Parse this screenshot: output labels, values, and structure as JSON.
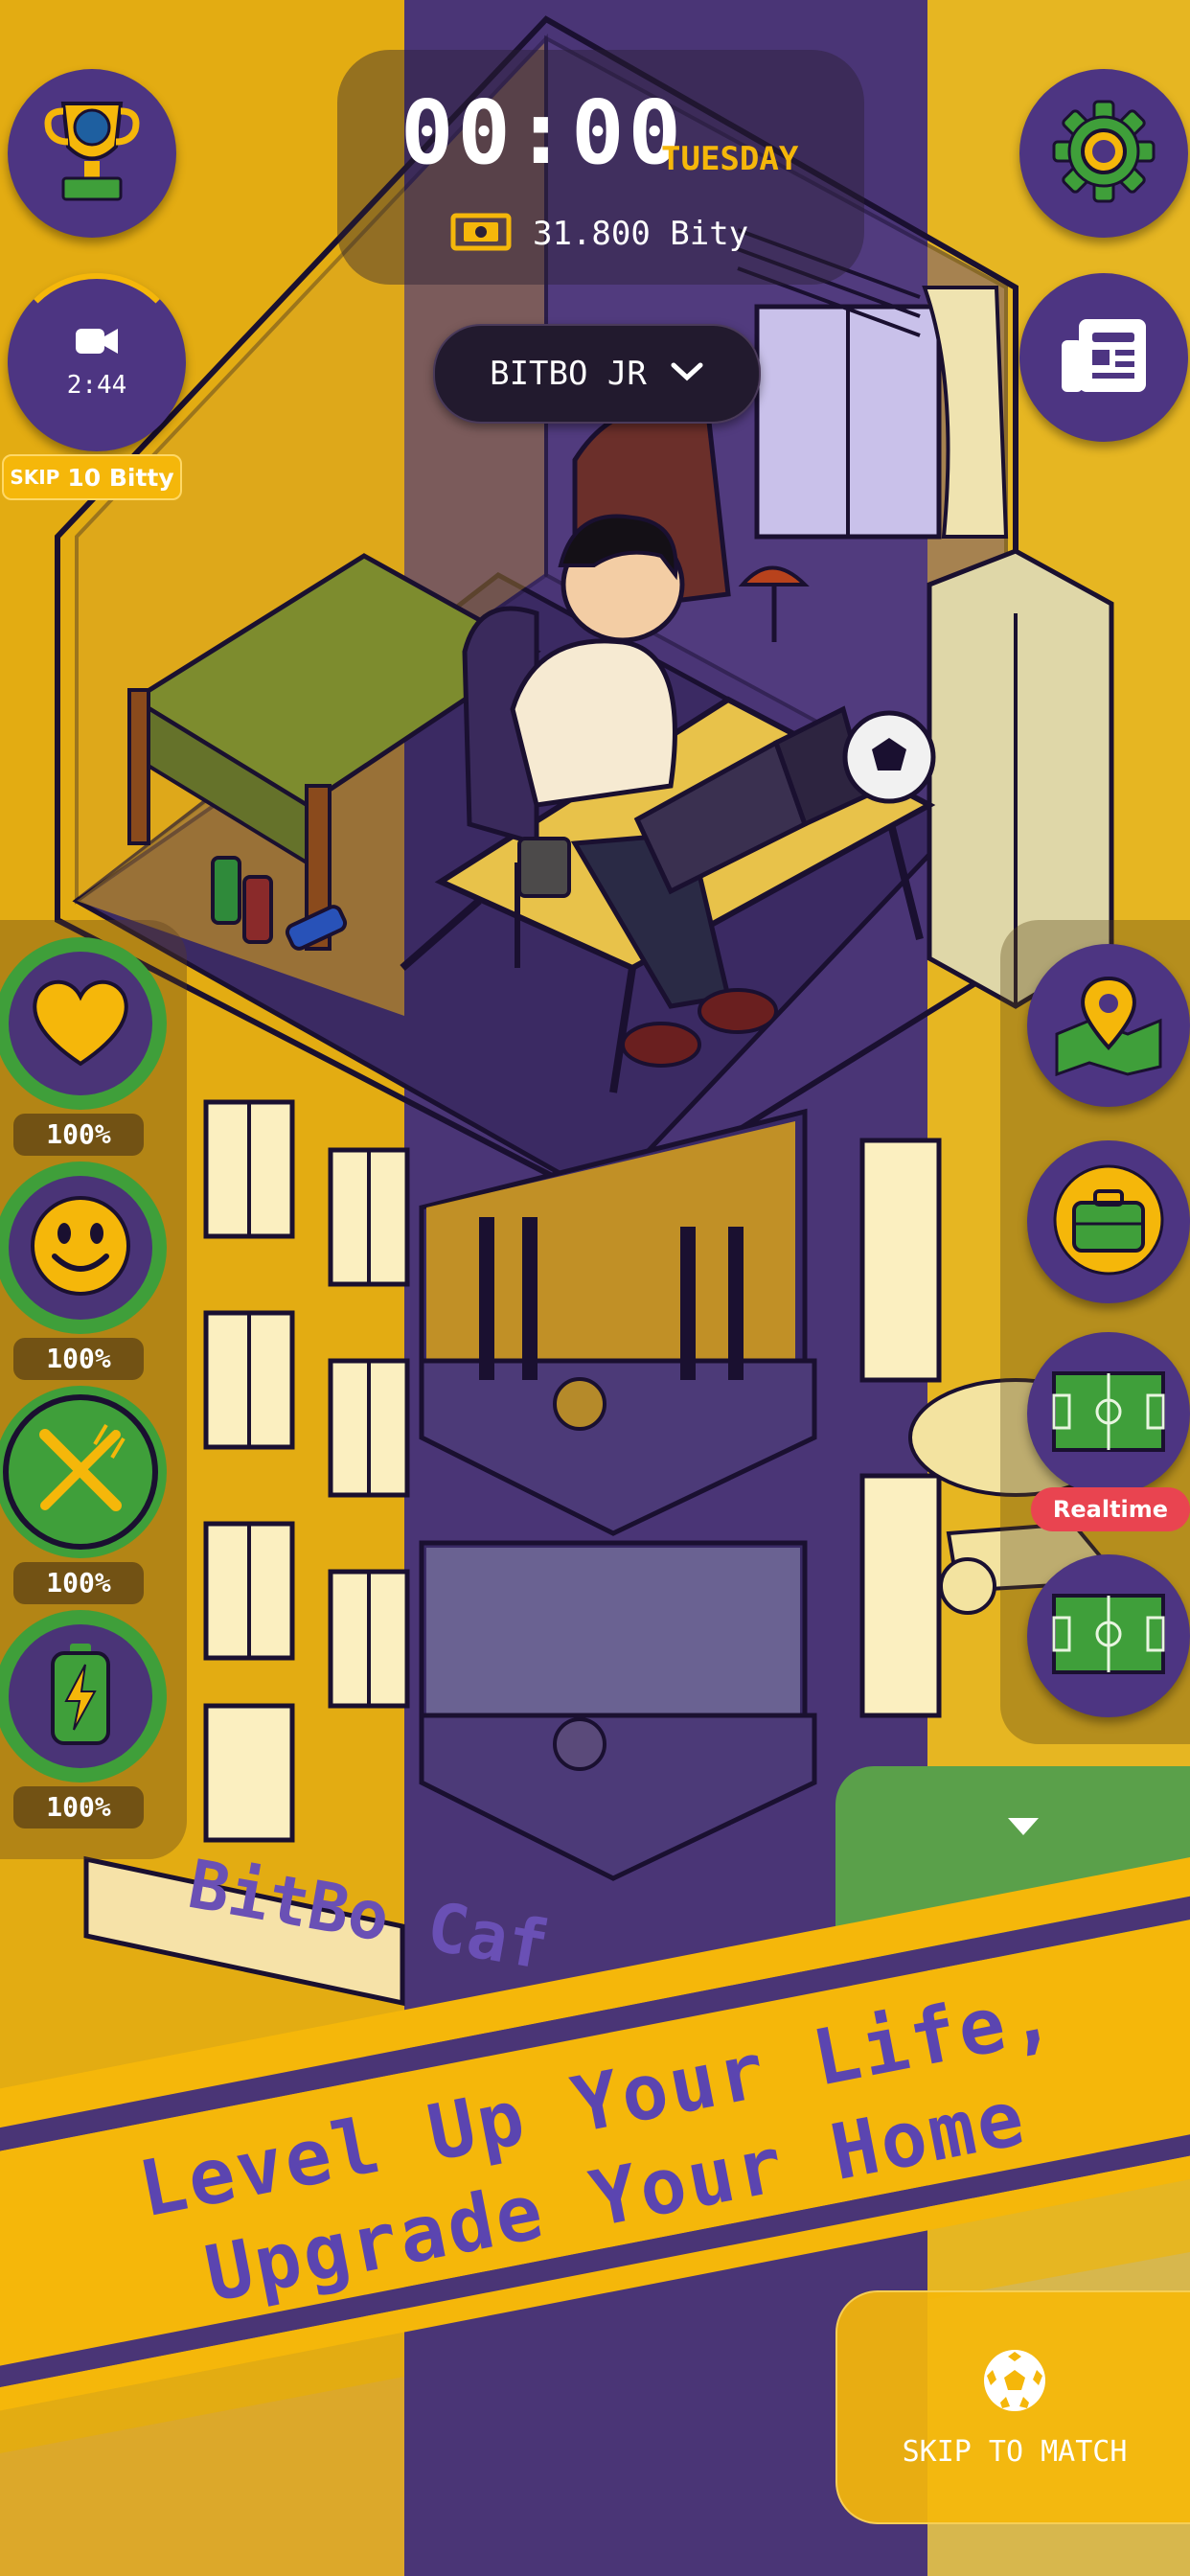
{
  "colors": {
    "primary_purple": "#4d3582",
    "accent_yellow": "#f5b70a",
    "stat_green": "#3f9f3a",
    "realtime_red": "#e94450"
  },
  "hud": {
    "clock": "00:00",
    "day": "TUESDAY",
    "balance": "31.800 Bity",
    "character_selector": "BITBO JR",
    "video_timer": "2:44",
    "skip_prefix": "SKIP",
    "skip_cost": "10 Bitty"
  },
  "left_buttons": {
    "trophy_icon": "trophy-globe-icon",
    "video_icon": "video-camera-icon"
  },
  "right_buttons": {
    "settings_icon": "gear-icon",
    "news_icon": "newspaper-icon",
    "map_icon": "map-pin-icon",
    "job_icon": "briefcase-icon",
    "match_realtime_icon": "football-pitch-icon",
    "match_icon": "football-pitch-icon",
    "realtime_badge": "Realtime"
  },
  "stats": [
    {
      "icon": "heart-icon",
      "value": "100%"
    },
    {
      "icon": "smiley-icon",
      "value": "100%"
    },
    {
      "icon": "fork-knife-icon",
      "value": "100%"
    },
    {
      "icon": "battery-icon",
      "value": "100%"
    }
  ],
  "scene": {
    "cafe_sign": "BitBo Caf"
  },
  "banner": {
    "line1": "Level Up Your Life,",
    "line2": "Upgrade Your Home"
  },
  "skip_match": {
    "label": "SKIP TO MATCH",
    "icon": "soccer-ball-icon"
  }
}
